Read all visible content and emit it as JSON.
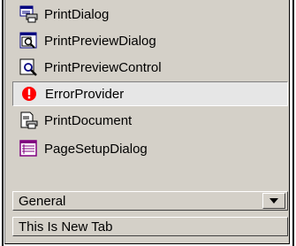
{
  "toolbox": {
    "items": [
      {
        "label": "PrintDialog",
        "icon": "print-dialog-icon"
      },
      {
        "label": "PrintPreviewDialog",
        "icon": "print-preview-dialog-icon"
      },
      {
        "label": "PrintPreviewControl",
        "icon": "print-preview-control-icon"
      },
      {
        "label": "ErrorProvider",
        "icon": "error-provider-icon",
        "selected": true
      },
      {
        "label": "PrintDocument",
        "icon": "print-document-icon"
      },
      {
        "label": "PageSetupDialog",
        "icon": "page-setup-dialog-icon"
      }
    ],
    "tabs": [
      {
        "label": "General",
        "icon": "dropdown-arrow-icon"
      },
      {
        "label": "This Is New Tab"
      }
    ]
  },
  "colors": {
    "panel_bg": "#d4d0c8",
    "selected_bg": "#e6e6e6",
    "error_red": "#ff0000",
    "icon_blue": "#000080",
    "icon_magenta": "#800080"
  }
}
